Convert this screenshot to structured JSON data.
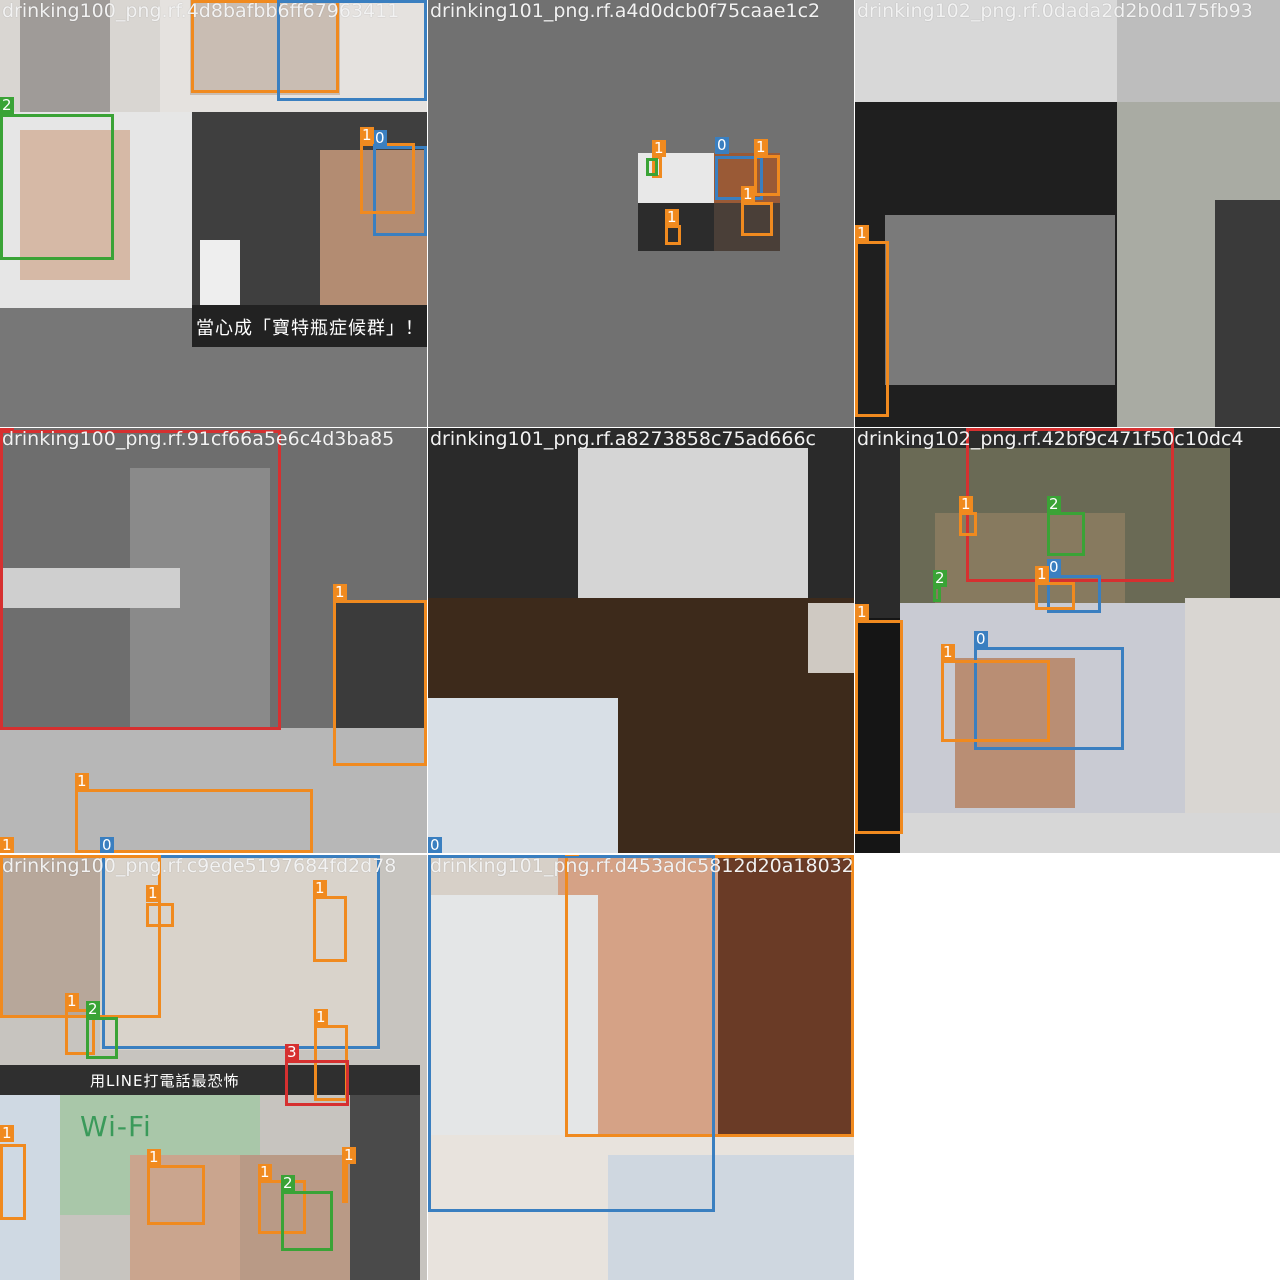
{
  "palette": {
    "class_0": "#3a7fc0",
    "class_1": "#f08a1f",
    "class_2": "#3aa336",
    "class_3": "#d63030"
  },
  "tiles": [
    {
      "title": "drinking100_png.rf.4d8bafbb6ff67963411"
    },
    {
      "title": "drinking101_png.rf.a4d0dcb0f75caae1c2"
    },
    {
      "title": "drinking102_png.rf.0dada2d2b0d175fb93"
    },
    {
      "title": "drinking100_png.rf.91cf66a5e6c4d3ba85"
    },
    {
      "title": "drinking101_png.rf.a8273858c75ad666c"
    },
    {
      "title": "drinking102_png.rf.42bf9c471f50c10dc4"
    },
    {
      "title": "drinking100_png.rf.c9ede5197684fd2d78"
    },
    {
      "title": "drinking101_png.rf.d453adc5812d20a18032"
    }
  ],
  "captions": {
    "chinese_subtitle": "當心成「寶特瓶症候群」！",
    "ad_text": "用LINE打電話最恐怖",
    "wifi_text": "Wi-Fi"
  },
  "labels": {
    "zero": "0",
    "one": "1",
    "two": "2",
    "three": "3"
  }
}
